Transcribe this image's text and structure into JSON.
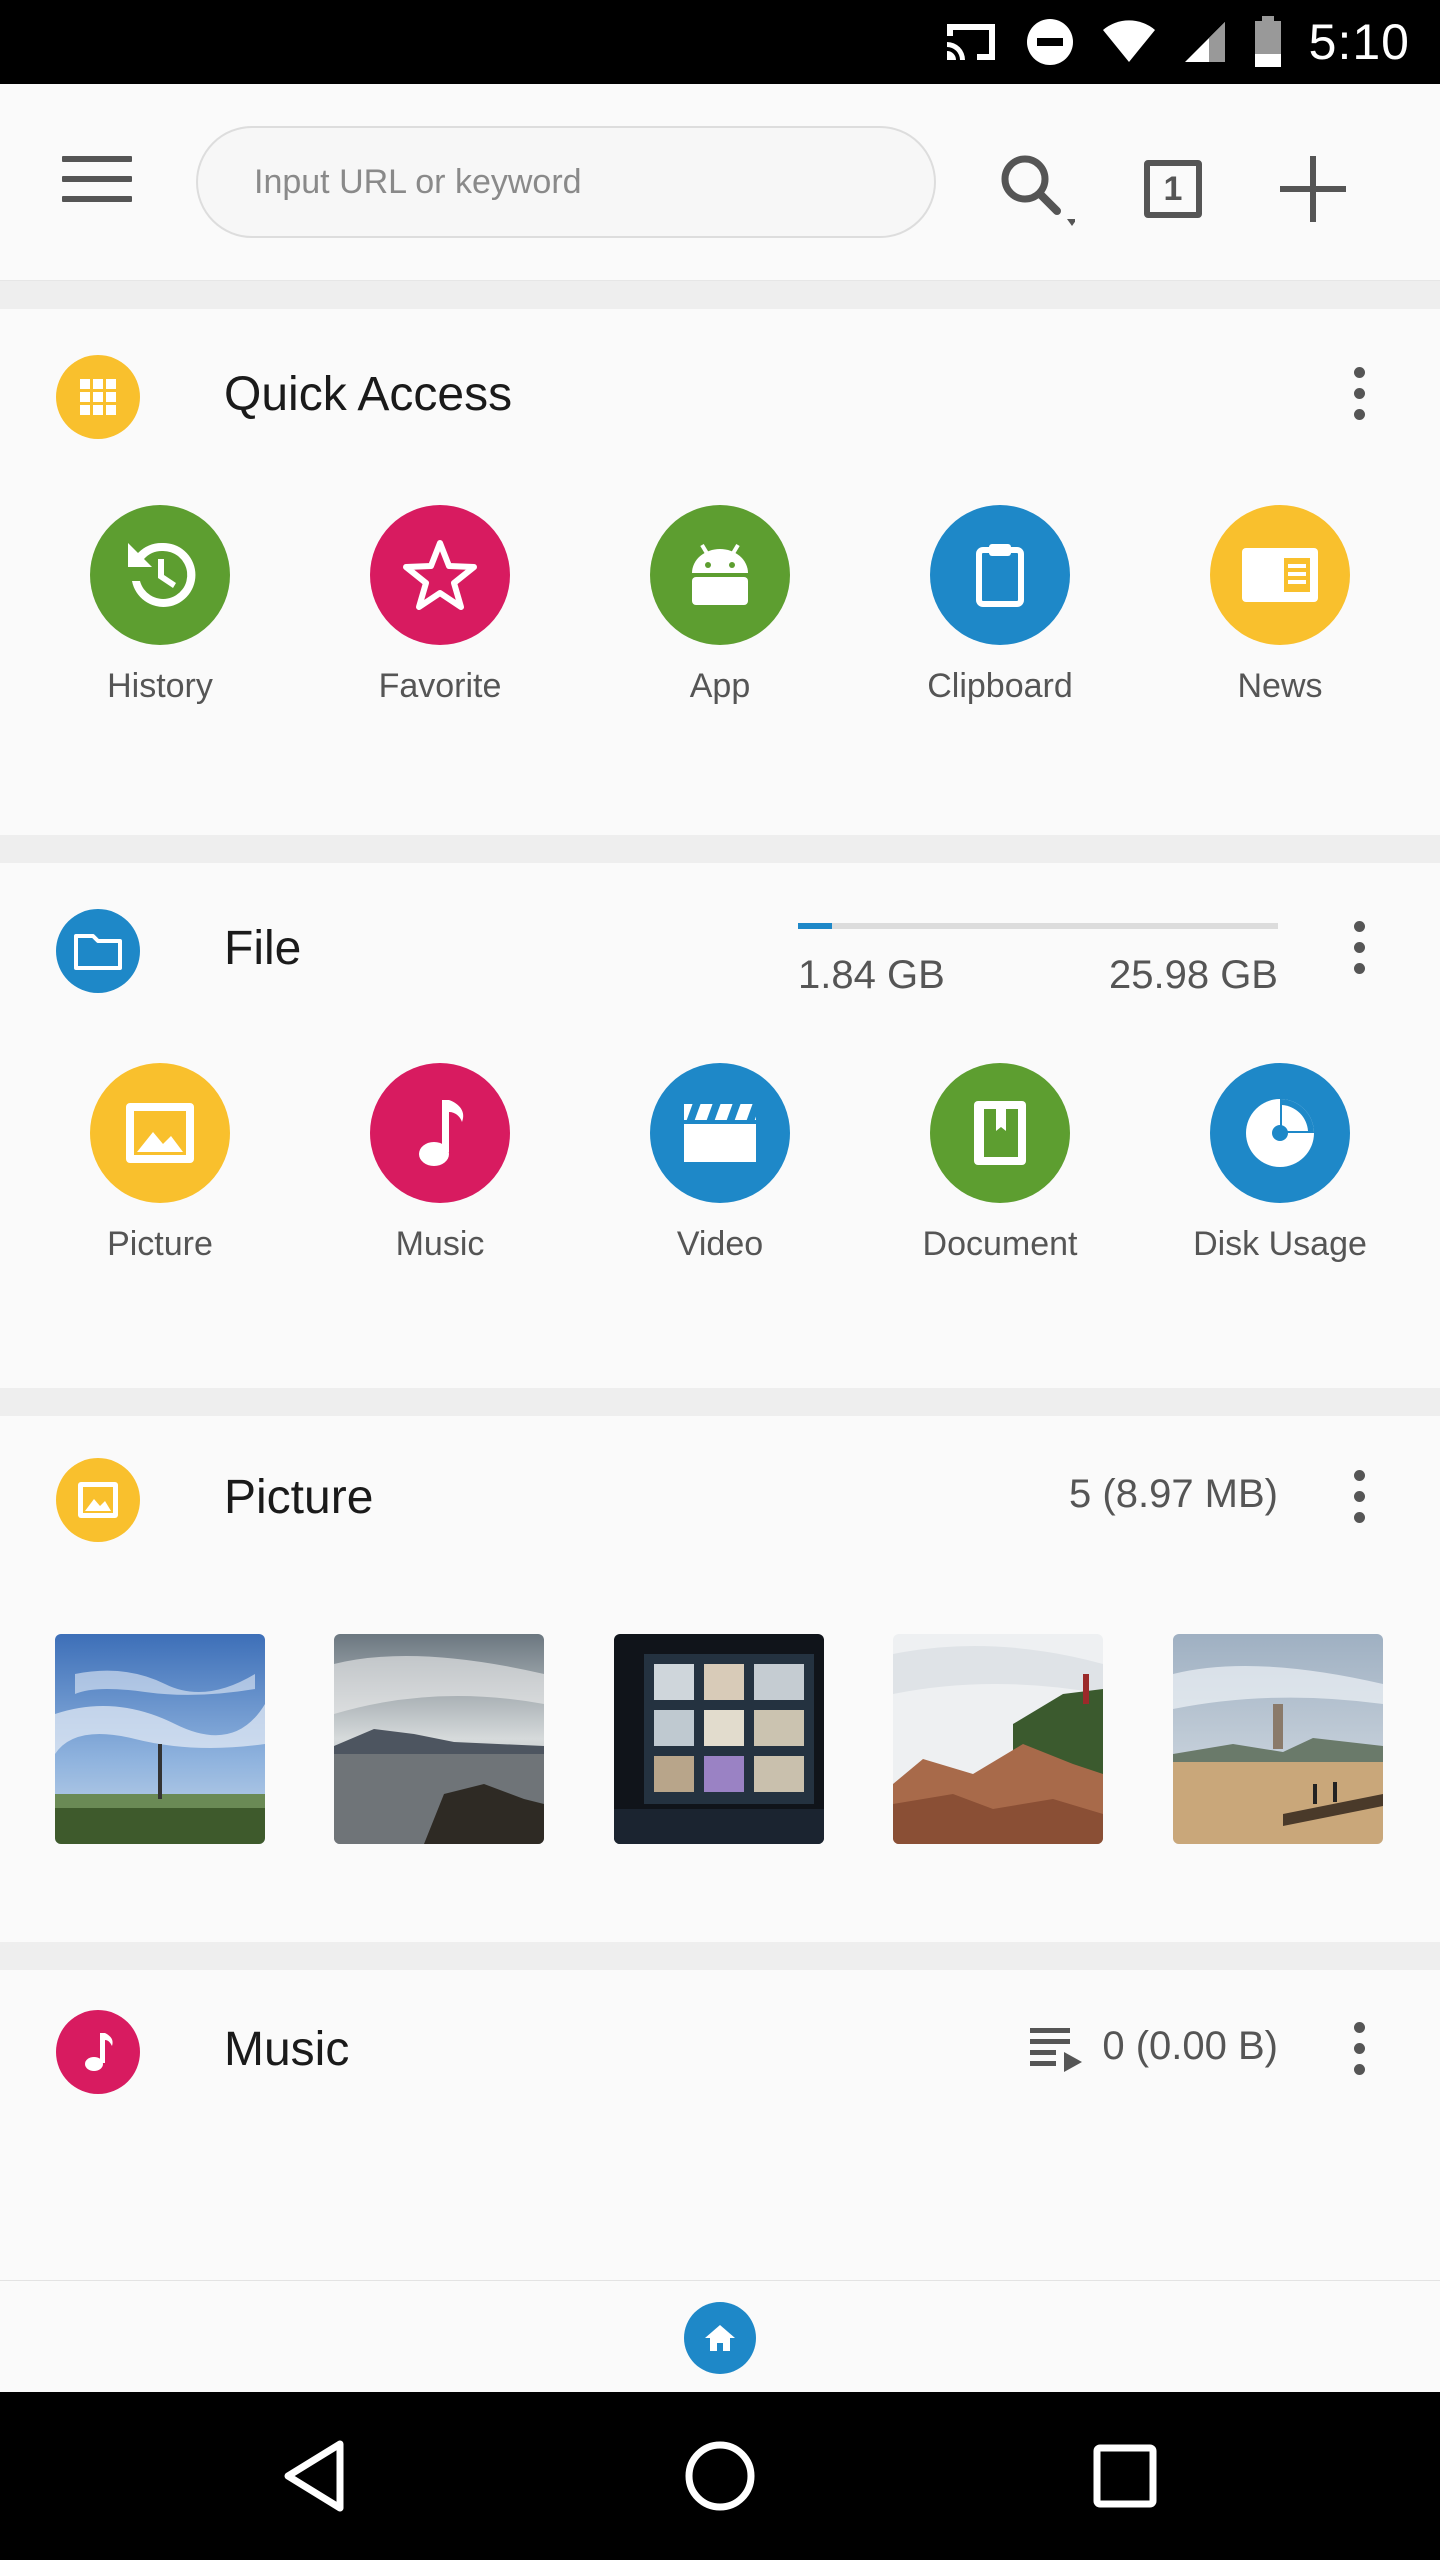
{
  "status_bar": {
    "time": "5:10"
  },
  "toolbar": {
    "url_placeholder": "Input URL or keyword",
    "tab_count": "1"
  },
  "quick_access": {
    "title": "Quick Access",
    "items": [
      {
        "label": "History",
        "icon": "history-icon",
        "color": "#5d9e30"
      },
      {
        "label": "Favorite",
        "icon": "star-icon",
        "color": "#d81b60"
      },
      {
        "label": "App",
        "icon": "android-icon",
        "color": "#5d9e30"
      },
      {
        "label": "Clipboard",
        "icon": "clipboard-icon",
        "color": "#1e88c8"
      },
      {
        "label": "News",
        "icon": "news-icon",
        "color": "#f9c02d"
      }
    ]
  },
  "file": {
    "title": "File",
    "used": "1.84 GB",
    "total": "25.98 GB",
    "used_fraction": 0.071,
    "items": [
      {
        "label": "Picture",
        "icon": "image-icon",
        "color": "#f9c02d"
      },
      {
        "label": "Music",
        "icon": "music-note-icon",
        "color": "#d81b60"
      },
      {
        "label": "Video",
        "icon": "clapperboard-icon",
        "color": "#1e88c8"
      },
      {
        "label": "Document",
        "icon": "book-icon",
        "color": "#5d9e30"
      },
      {
        "label": "Disk Usage",
        "icon": "pie-chart-icon",
        "color": "#1e88c8"
      }
    ]
  },
  "picture": {
    "title": "Picture",
    "summary": "5 (8.97 MB)",
    "thumbnails": [
      "sky-landscape",
      "sea-rocks",
      "museum-shelves",
      "coastal-cliff",
      "beach-pier"
    ]
  },
  "music": {
    "title": "Music",
    "summary": "0 (0.00 B)"
  },
  "colors": {
    "yellow": "#f9c02d",
    "blue": "#1e88c8",
    "green": "#5d9e30",
    "pink": "#d81b60"
  }
}
